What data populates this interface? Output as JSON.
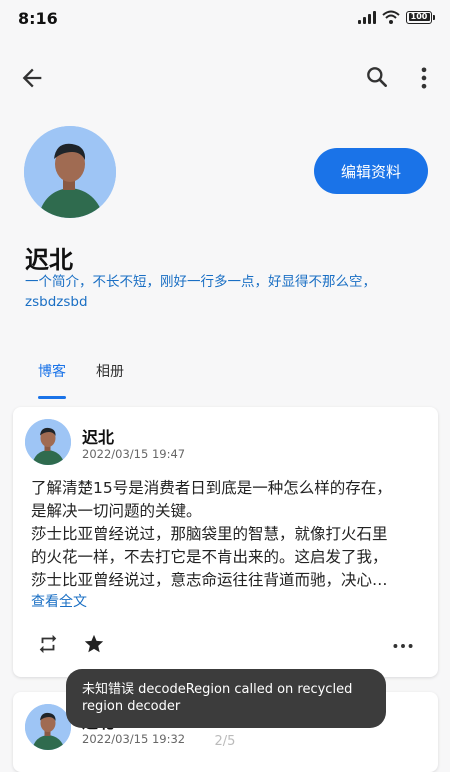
{
  "status": {
    "time": "8:16",
    "battery": "100"
  },
  "toolbar": {
    "back_icon": "arrow-left-icon",
    "search_icon": "search-icon",
    "more_icon": "more-vertical-icon"
  },
  "profile": {
    "name": "迟北",
    "bio_line1": "一个简介，不长不短，刚好一行多一点，好显得不那么空，",
    "bio_line2": "zsbdzsbd",
    "edit_label": "编辑资料"
  },
  "tabs": {
    "blog": "博客",
    "album": "相册"
  },
  "posts": [
    {
      "author": "迟北",
      "time": "2022/03/15 19:47",
      "line1": "了解清楚15号是消费者日到底是一种怎么样的存在，",
      "line2": "是解决一切问题的关键。",
      "line3": "莎士比亚曾经说过，那脑袋里的智慧，就像打火石里",
      "line4": "的火花一样，不去打它是不肯出来的。这启发了我，",
      "line5": "莎士比亚曾经说过，意志命运往往背道而驰，决心…",
      "read_more": "查看全文"
    },
    {
      "author": "迟北",
      "time": "2022/03/15 19:32"
    }
  ],
  "pager": "2/5",
  "toast": {
    "line1": "未知错误 decodeRegion called on recycled",
    "line2": "region decoder"
  },
  "colors": {
    "accent": "#1a73e8",
    "bio": "#1a6fc4",
    "avatar_bg": "#9ec5f5"
  }
}
